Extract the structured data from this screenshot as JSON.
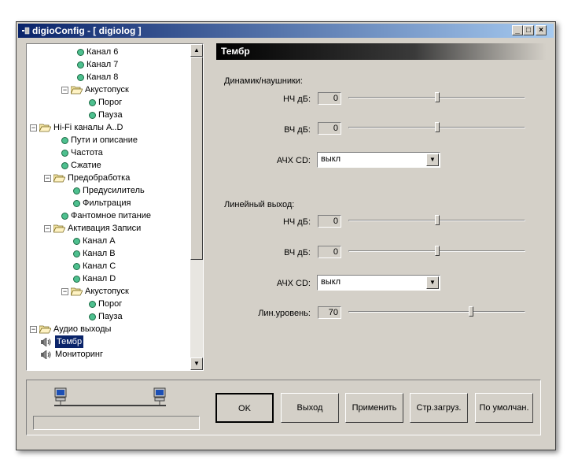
{
  "window": {
    "title": "digioConfig - [ digiolog ]",
    "controls": {
      "minimize": "_",
      "maximize": "□",
      "close": "×"
    }
  },
  "tree": {
    "items": [
      {
        "label": "Канал 6",
        "icon": "green-dot-icon"
      },
      {
        "label": "Канал 7",
        "icon": "green-dot-icon"
      },
      {
        "label": "Канал 8",
        "icon": "green-dot-icon"
      },
      {
        "label": "Акустопуск",
        "icon": "folder-open-icon",
        "expander": "−"
      },
      {
        "label": "Порог",
        "icon": "green-dot-icon"
      },
      {
        "label": "Пауза",
        "icon": "green-dot-icon"
      },
      {
        "label": "Hi-Fi каналы A..D",
        "icon": "folder-open-icon",
        "expander": "−"
      },
      {
        "label": "Пути и описание",
        "icon": "green-dot-icon"
      },
      {
        "label": "Частота",
        "icon": "green-dot-icon"
      },
      {
        "label": "Сжатие",
        "icon": "green-dot-icon"
      },
      {
        "label": "Предобработка",
        "icon": "folder-open-icon",
        "expander": "−"
      },
      {
        "label": "Предусилитель",
        "icon": "green-dot-icon"
      },
      {
        "label": "Фильтрация",
        "icon": "green-dot-icon"
      },
      {
        "label": "Фантомное питание",
        "icon": "green-dot-icon"
      },
      {
        "label": "Активация Записи",
        "icon": "folder-open-icon",
        "expander": "−"
      },
      {
        "label": "Канал A",
        "icon": "green-dot-icon"
      },
      {
        "label": "Канал B",
        "icon": "green-dot-icon"
      },
      {
        "label": "Канал C",
        "icon": "green-dot-icon"
      },
      {
        "label": "Канал D",
        "icon": "green-dot-icon"
      },
      {
        "label": "Акустопуск",
        "icon": "folder-open-icon",
        "expander": "−"
      },
      {
        "label": "Порог",
        "icon": "green-dot-icon"
      },
      {
        "label": "Пауза",
        "icon": "green-dot-icon"
      },
      {
        "label": "Аудио выходы",
        "icon": "folder-open-icon",
        "expander": "−"
      },
      {
        "label": "Тембр",
        "icon": "speaker-icon",
        "selected": true
      },
      {
        "label": "Мониторинг",
        "icon": "speaker-icon"
      }
    ]
  },
  "panel": {
    "title": "Тембр",
    "speakers": {
      "section": "Динамик/наушники:",
      "low_label": "НЧ дБ:",
      "low_value": "0",
      "low_level": 0.5,
      "high_label": "ВЧ дБ:",
      "high_value": "0",
      "high_level": 0.5,
      "afc_label": "АЧХ CD:",
      "afc_value": "выкл"
    },
    "line_out": {
      "section": "Линейный выход:",
      "low_label": "НЧ дБ:",
      "low_value": "0",
      "low_level": 0.5,
      "high_label": "ВЧ дБ:",
      "high_value": "0",
      "high_level": 0.5,
      "afc_label": "АЧХ CD:",
      "afc_value": "выкл",
      "level_label": "Лин.уровень:",
      "level_value": "70",
      "level_level": 0.7
    }
  },
  "buttons": {
    "ok": "OK",
    "exit": "Выход",
    "apply": "Применить",
    "load_page": "Стр.загруз.",
    "defaults": "По умолчан."
  }
}
